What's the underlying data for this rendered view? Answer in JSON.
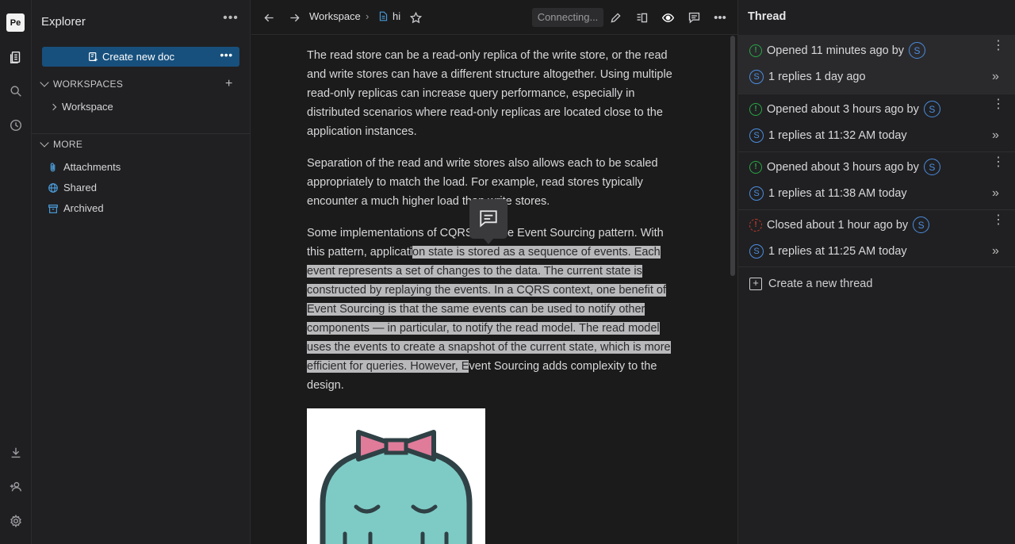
{
  "app": {
    "logo": "Pe"
  },
  "rail": {
    "icons": [
      "documents-icon",
      "search-icon",
      "recent-icon",
      "download-icon",
      "invite-icon",
      "settings-icon"
    ]
  },
  "navigator": {
    "title": "Explorer",
    "more": "•••",
    "create_label": "Create new doc",
    "create_more": "•••",
    "workspaces_header": "WORKSPACES",
    "workspace_item": "Workspace",
    "more_header": "MORE",
    "more_items": [
      "Attachments",
      "Shared",
      "Archived"
    ]
  },
  "topbar": {
    "breadcrumb_workspace": "Workspace",
    "doc_title": "hi",
    "connection_status": "Connecting..."
  },
  "document": {
    "p1": "The read store can be a read-only replica of the write store, or the read and write stores can have a different structure altogether. Using multiple read-only replicas can increase query performance, especially in distributed scenarios where read-only replicas are located close to the application instances.",
    "p2": "Separation of the read and write stores also allows each to be scaled appropriately to match the load. For example, read stores typically encounter a much higher load than write stores.",
    "p3_before": "Some implementations of CQRS use the Event Sourcing pattern. With this pattern, applicati",
    "p3_selected": "on state is stored as a sequence of events. Each event represents a set of changes to the data. The current state is constructed by replaying the events. In a CQRS context, one benefit of Event Sourcing is that the same events can be used to notify other components — in particular, to notify the read model. The read model uses the events to create a snapshot of the current state, which is more efficient for queries. However, E",
    "p3_after": "vent Sourcing adds complexity to the design."
  },
  "thread_panel": {
    "title": "Thread",
    "threads": [
      {
        "status": "open",
        "opened": "Opened 11 minutes ago by",
        "author": "S",
        "replies": "1 replies 1 day ago"
      },
      {
        "status": "open",
        "opened": "Opened about 3 hours ago by",
        "author": "S",
        "replies": "1 replies at 11:32 AM today"
      },
      {
        "status": "open",
        "opened": "Opened about 3 hours ago by",
        "author": "S",
        "replies": "1 replies at 11:38 AM today"
      },
      {
        "status": "closed",
        "opened": "Closed about 1 hour ago by",
        "author": "S",
        "replies": "1 replies at 11:25 AM today"
      }
    ],
    "new_thread": "Create a new thread"
  },
  "colors": {
    "accent": "#17507d",
    "open_status": "#28a745",
    "closed_status": "#c0392b",
    "avatar": "#4b8de0"
  }
}
